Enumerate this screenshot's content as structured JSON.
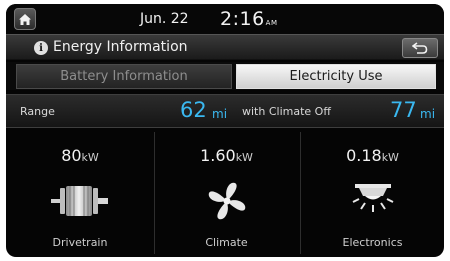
{
  "status": {
    "date": "Jun. 22",
    "time": "2:16",
    "ampm": "AM"
  },
  "header": {
    "title": "Energy Information"
  },
  "tabs": [
    {
      "label": "Battery Information",
      "active": false
    },
    {
      "label": "Electricity Use",
      "active": true
    }
  ],
  "range": {
    "label": "Range",
    "value": "62",
    "unit": "mi",
    "climate_off_label": "with Climate Off",
    "climate_off_value": "77",
    "climate_off_unit": "mi"
  },
  "consumers": [
    {
      "value": "80",
      "unit": "kW",
      "label": "Drivetrain",
      "icon": "drivetrain-icon"
    },
    {
      "value": "1.60",
      "unit": "kW",
      "label": "Climate",
      "icon": "fan-icon"
    },
    {
      "value": "0.18",
      "unit": "kW",
      "label": "Electronics",
      "icon": "light-icon"
    }
  ],
  "colors": {
    "accent": "#3ab8f0",
    "background": "#050505"
  }
}
